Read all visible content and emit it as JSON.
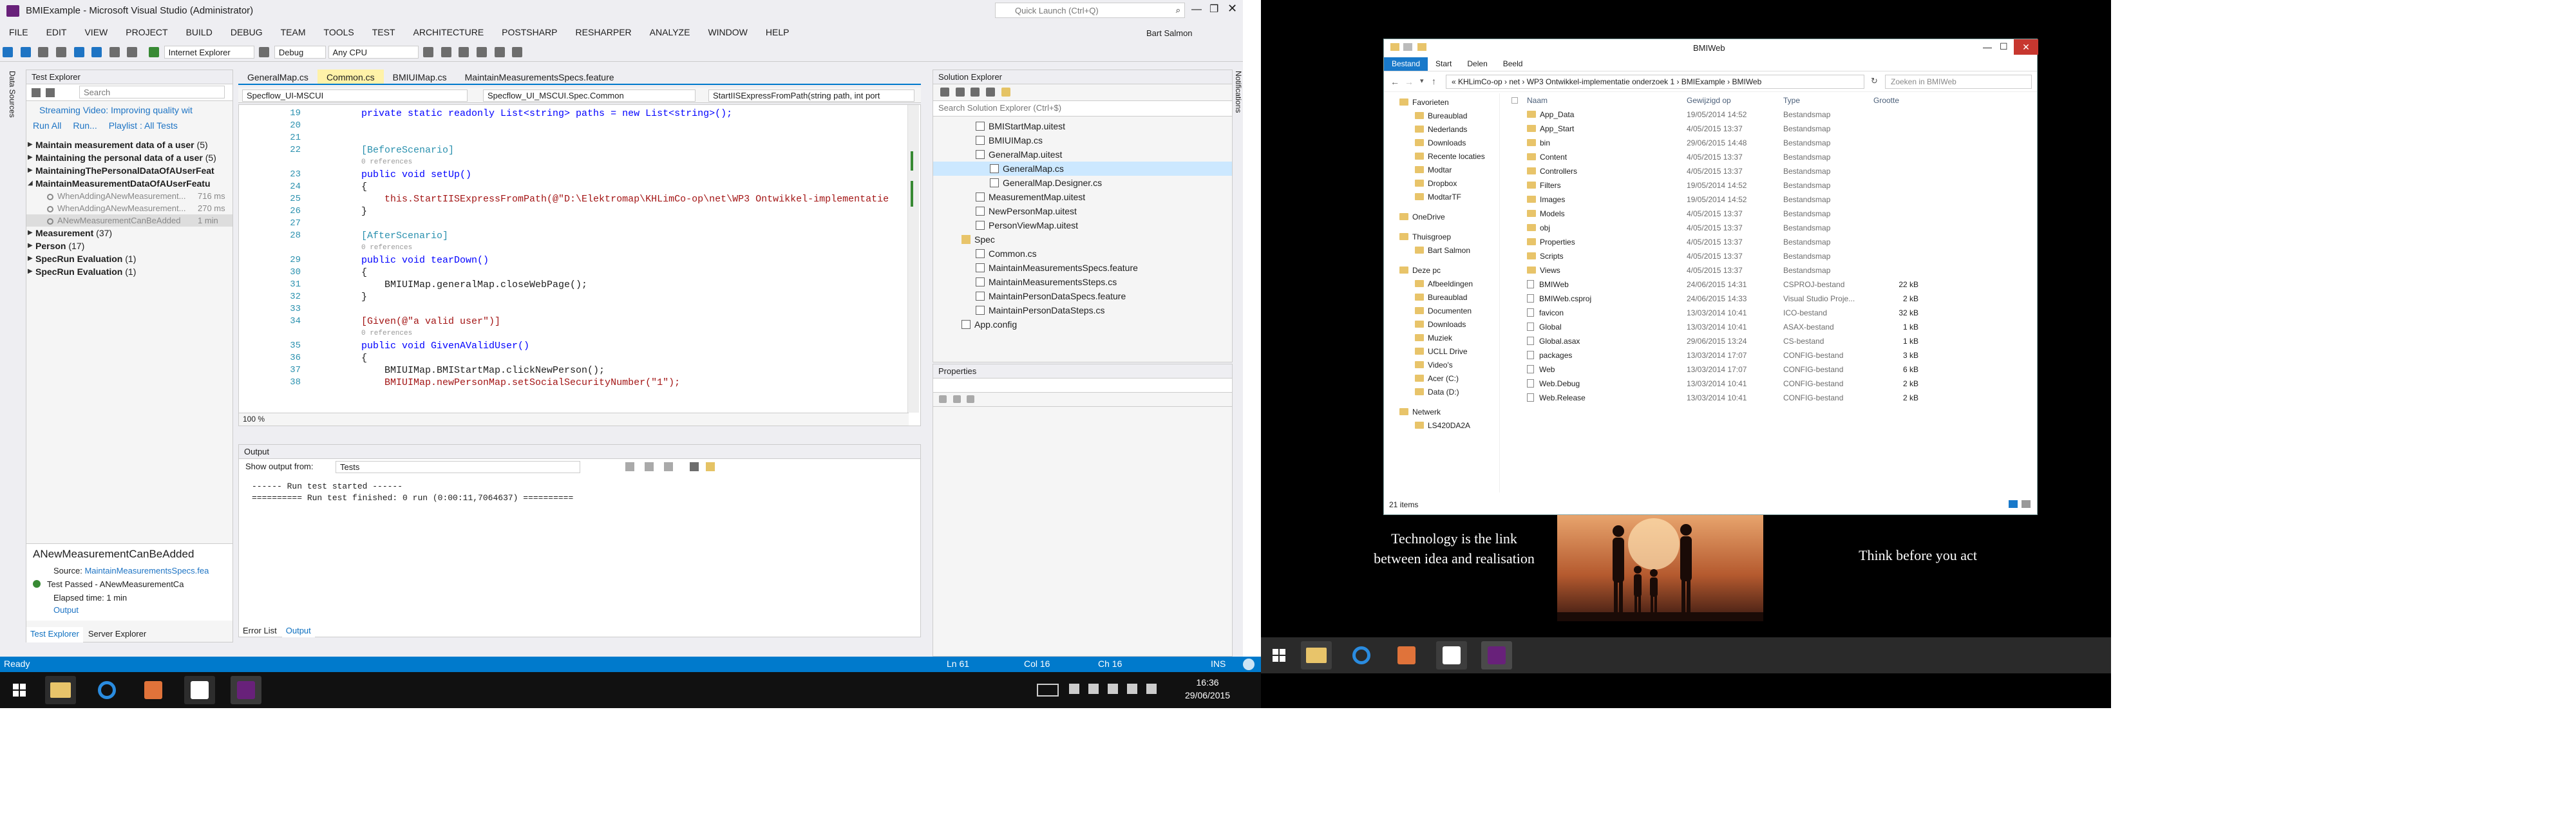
{
  "vs": {
    "title": "BMIExample - Microsoft Visual Studio (Administrator)",
    "quick_launch": "Quick Launch (Ctrl+Q)",
    "user": "Bart Salmon",
    "menu": [
      "FILE",
      "EDIT",
      "VIEW",
      "PROJECT",
      "BUILD",
      "DEBUG",
      "TEAM",
      "TOOLS",
      "TEST",
      "ARCHITECTURE",
      "POSTSHARP",
      "RESHARPER",
      "ANALYZE",
      "WINDOW",
      "HELP"
    ],
    "toolbar": {
      "browser": "Internet Explorer",
      "config": "Debug",
      "platform": "Any CPU"
    },
    "side_tabs": {
      "left": "Data Sources",
      "right": "Notifications"
    }
  },
  "test_explorer": {
    "title": "Test Explorer",
    "search_placeholder": "Search",
    "streaming": "Streaming Video: Improving quality wit",
    "run_all": "Run All",
    "run": "Run...",
    "playlist": "Playlist : All Tests",
    "groups": [
      {
        "label": "Maintain measurement data of a user",
        "count": "(5)"
      },
      {
        "label": "Maintaining the personal data of a user",
        "count": "(5)"
      },
      {
        "label": "MaintainingThePersonalDataOfAUserFeat",
        "count": ""
      },
      {
        "label": "MaintainMeasurementDataOfAUserFeatu",
        "count": ""
      }
    ],
    "children": [
      {
        "label": "WhenAddingANewMeasurement...",
        "time": "716 ms"
      },
      {
        "label": "WhenAddingANewMeasurement...",
        "time": "270 ms"
      },
      {
        "label": "ANewMeasurementCanBeAdded",
        "time": "1 min"
      }
    ],
    "groups2": [
      {
        "label": "Measurement",
        "count": "(37)"
      },
      {
        "label": "Person",
        "count": "(17)"
      },
      {
        "label": "SpecRun Evaluation",
        "count": "(1)"
      },
      {
        "label": "SpecRun Evaluation",
        "count": "(1)"
      }
    ],
    "detail": {
      "name": "ANewMeasurementCanBeAdded",
      "source_label": "Source:",
      "source": "MaintainMeasurementsSpecs.fea",
      "passed": "Test Passed - ANewMeasurementCa",
      "elapsed": "Elapsed time: 1 min",
      "output": "Output"
    },
    "bottom_tabs": [
      "Test Explorer",
      "Server Explorer"
    ]
  },
  "editor": {
    "tabs": [
      "GeneralMap.cs",
      "Common.cs",
      "BMIUIMap.cs",
      "MaintainMeasurementsSpecs.feature"
    ],
    "nav": [
      "Specflow_UI-MSCUI",
      "Specflow_UI_MSCUI.Spec.Common",
      "StartIISExpressFromPath(string path, int port"
    ],
    "zoom": "100 %",
    "lines": [
      {
        "n": "19",
        "t": "private static readonly List<string> paths = new List<string>();"
      },
      {
        "n": "20",
        "t": ""
      },
      {
        "n": "21",
        "t": ""
      },
      {
        "n": "22",
        "t": "[BeforeScenario]"
      },
      {
        "n": "",
        "t": "0 references"
      },
      {
        "n": "23",
        "t": "public void setUp()"
      },
      {
        "n": "24",
        "t": "{"
      },
      {
        "n": "25",
        "t": "    this.StartIISExpressFromPath(@\"D:\\Elektromap\\KHLimCo-op\\net\\WP3 Ontwikkel-implementatie"
      },
      {
        "n": "26",
        "t": "}"
      },
      {
        "n": "27",
        "t": ""
      },
      {
        "n": "28",
        "t": "[AfterScenario]"
      },
      {
        "n": "",
        "t": "0 references"
      },
      {
        "n": "29",
        "t": "public void tearDown()"
      },
      {
        "n": "30",
        "t": "{"
      },
      {
        "n": "31",
        "t": "    BMIUIMap.generalMap.closeWebPage();"
      },
      {
        "n": "32",
        "t": "}"
      },
      {
        "n": "33",
        "t": ""
      },
      {
        "n": "34",
        "t": "[Given(@\"a valid user\")]"
      },
      {
        "n": "",
        "t": "0 references"
      },
      {
        "n": "35",
        "t": "public void GivenAValidUser()"
      },
      {
        "n": "36",
        "t": "{"
      },
      {
        "n": "37",
        "t": "    BMIUIMap.BMIStartMap.clickNewPerson();"
      },
      {
        "n": "38",
        "t": "    BMIUIMap.newPersonMap.setSocialSecurityNumber(\"1\");"
      }
    ]
  },
  "output": {
    "title": "Output",
    "show_from": "Show output from:",
    "source": "Tests",
    "lines": [
      "------ Run test started ------",
      "========== Run test finished: 0 run (0:00:11,7064637) =========="
    ],
    "bottom_tabs": [
      "Error List",
      "Output"
    ]
  },
  "solution_explorer": {
    "title": "Solution Explorer",
    "search": "Search Solution Explorer (Ctrl+$)",
    "items": [
      {
        "label": "BMIStartMap.uitest",
        "indent": 3
      },
      {
        "label": "BMIUIMap.cs",
        "indent": 3
      },
      {
        "label": "GeneralMap.uitest",
        "indent": 3
      },
      {
        "label": "GeneralMap.cs",
        "indent": 4,
        "selected": true
      },
      {
        "label": "GeneralMap.Designer.cs",
        "indent": 4
      },
      {
        "label": "MeasurementMap.uitest",
        "indent": 3
      },
      {
        "label": "NewPersonMap.uitest",
        "indent": 3
      },
      {
        "label": "PersonViewMap.uitest",
        "indent": 3
      },
      {
        "label": "Spec",
        "indent": 2
      },
      {
        "label": "Common.cs",
        "indent": 3
      },
      {
        "label": "MaintainMeasurementsSpecs.feature",
        "indent": 3
      },
      {
        "label": "MaintainMeasurementsSteps.cs",
        "indent": 3
      },
      {
        "label": "MaintainPersonDataSpecs.feature",
        "indent": 3
      },
      {
        "label": "MaintainPersonDataSteps.cs",
        "indent": 3
      },
      {
        "label": "App.config",
        "indent": 2
      }
    ]
  },
  "properties": {
    "title": "Properties"
  },
  "status": {
    "ready": "Ready",
    "ln": "Ln 61",
    "col": "Col 16",
    "ch": "Ch 16",
    "ins": "INS"
  },
  "clock": {
    "time": "16:36",
    "date": "29/06/2015"
  },
  "file_explorer": {
    "title": "BMIWeb",
    "ribbon": [
      "Bestand",
      "Start",
      "Delen",
      "Beeld"
    ],
    "path": "« KHLimCo-op › net › WP3 Ontwikkel-implementatie onderzoek 1 › BMIExample › BMIWeb",
    "search": "Zoeken in BMIWeb",
    "columns": [
      "Naam",
      "Gewijzigd op",
      "Type",
      "Grootte"
    ],
    "nav": [
      {
        "label": "Favorieten",
        "level": 0
      },
      {
        "label": "Bureaublad",
        "level": 1
      },
      {
        "label": "Nederlands",
        "level": 1
      },
      {
        "label": "Downloads",
        "level": 1
      },
      {
        "label": "Recente locaties",
        "level": 1
      },
      {
        "label": "Modtar",
        "level": 1
      },
      {
        "label": "Dropbox",
        "level": 1
      },
      {
        "label": "ModtarTF",
        "level": 1
      },
      {
        "label": "",
        "level": 0
      },
      {
        "label": "OneDrive",
        "level": 0
      },
      {
        "label": "",
        "level": 0
      },
      {
        "label": "Thuisgroep",
        "level": 0
      },
      {
        "label": "Bart Salmon",
        "level": 1
      },
      {
        "label": "",
        "level": 0
      },
      {
        "label": "Deze pc",
        "level": 0
      },
      {
        "label": "Afbeeldingen",
        "level": 1
      },
      {
        "label": "Bureaublad",
        "level": 1
      },
      {
        "label": "Documenten",
        "level": 1
      },
      {
        "label": "Downloads",
        "level": 1
      },
      {
        "label": "Muziek",
        "level": 1
      },
      {
        "label": "UCLL Drive",
        "level": 1
      },
      {
        "label": "Video's",
        "level": 1
      },
      {
        "label": "Acer (C:)",
        "level": 1
      },
      {
        "label": "Data (D:)",
        "level": 1
      },
      {
        "label": "",
        "level": 0
      },
      {
        "label": "Netwerk",
        "level": 0
      },
      {
        "label": "LS420DA2A",
        "level": 1
      }
    ],
    "files": [
      {
        "name": "App_Data",
        "date": "19/05/2014 14:52",
        "type": "Bestandsmap",
        "size": "",
        "folder": true
      },
      {
        "name": "App_Start",
        "date": "4/05/2015 13:37",
        "type": "Bestandsmap",
        "size": "",
        "folder": true
      },
      {
        "name": "bin",
        "date": "29/06/2015 14:48",
        "type": "Bestandsmap",
        "size": "",
        "folder": true
      },
      {
        "name": "Content",
        "date": "4/05/2015 13:37",
        "type": "Bestandsmap",
        "size": "",
        "folder": true
      },
      {
        "name": "Controllers",
        "date": "4/05/2015 13:37",
        "type": "Bestandsmap",
        "size": "",
        "folder": true
      },
      {
        "name": "Filters",
        "date": "19/05/2014 14:52",
        "type": "Bestandsmap",
        "size": "",
        "folder": true
      },
      {
        "name": "Images",
        "date": "19/05/2014 14:52",
        "type": "Bestandsmap",
        "size": "",
        "folder": true
      },
      {
        "name": "Models",
        "date": "4/05/2015 13:37",
        "type": "Bestandsmap",
        "size": "",
        "folder": true
      },
      {
        "name": "obj",
        "date": "4/05/2015 13:37",
        "type": "Bestandsmap",
        "size": "",
        "folder": true
      },
      {
        "name": "Properties",
        "date": "4/05/2015 13:37",
        "type": "Bestandsmap",
        "size": "",
        "folder": true
      },
      {
        "name": "Scripts",
        "date": "4/05/2015 13:37",
        "type": "Bestandsmap",
        "size": "",
        "folder": true
      },
      {
        "name": "Views",
        "date": "4/05/2015 13:37",
        "type": "Bestandsmap",
        "size": "",
        "folder": true
      },
      {
        "name": "BMIWeb",
        "date": "24/06/2015 14:31",
        "type": "CSPROJ-bestand",
        "size": "22 kB",
        "folder": false
      },
      {
        "name": "BMIWeb.csproj",
        "date": "24/06/2015 14:33",
        "type": "Visual Studio Proje...",
        "size": "2 kB",
        "folder": false
      },
      {
        "name": "favicon",
        "date": "13/03/2014 10:41",
        "type": "ICO-bestand",
        "size": "32 kB",
        "folder": false
      },
      {
        "name": "Global",
        "date": "13/03/2014 10:41",
        "type": "ASAX-bestand",
        "size": "1 kB",
        "folder": false
      },
      {
        "name": "Global.asax",
        "date": "29/06/2015 13:24",
        "type": "CS-bestand",
        "size": "1 kB",
        "folder": false
      },
      {
        "name": "packages",
        "date": "13/03/2014 17:07",
        "type": "CONFIG-bestand",
        "size": "3 kB",
        "folder": false
      },
      {
        "name": "Web",
        "date": "13/03/2014 17:07",
        "type": "CONFIG-bestand",
        "size": "6 kB",
        "folder": false
      },
      {
        "name": "Web.Debug",
        "date": "13/03/2014 10:41",
        "type": "CONFIG-bestand",
        "size": "2 kB",
        "folder": false
      },
      {
        "name": "Web.Release",
        "date": "13/03/2014 10:41",
        "type": "CONFIG-bestand",
        "size": "2 kB",
        "folder": false
      }
    ],
    "count": "21 items"
  },
  "wallpaper": {
    "left_quote": "Technology is the link\nbetween idea and realisation",
    "right_quote": "Think before you act"
  },
  "colors": {
    "accent": "#007acc",
    "vs_purple": "#68217a",
    "taskbar": "#111111"
  }
}
